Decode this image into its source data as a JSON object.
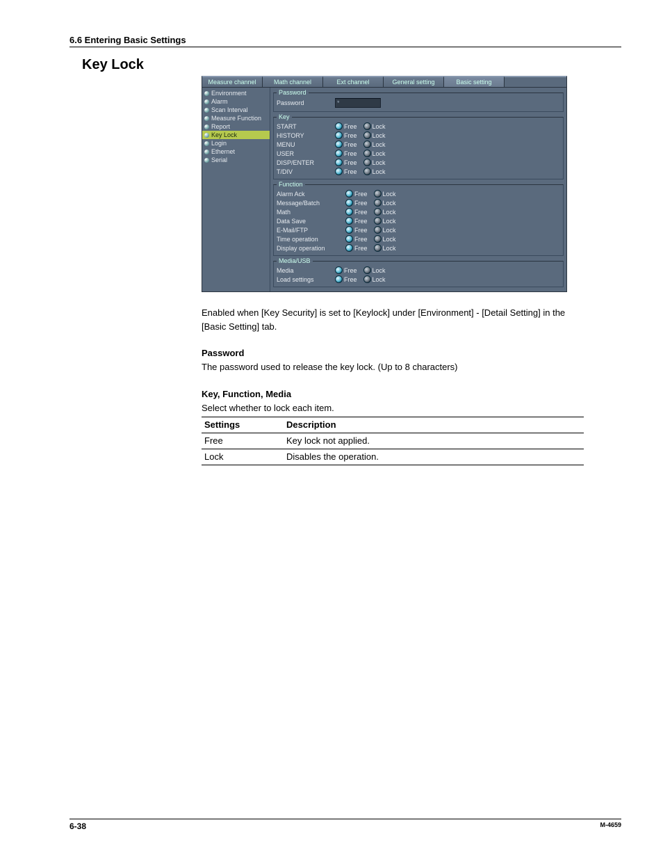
{
  "page": {
    "section_header": "6.6  Entering Basic Settings",
    "title": "Key Lock",
    "page_number": "6-38",
    "doc_id": "M-4659"
  },
  "screenshot": {
    "tabs": [
      "Measure channel",
      "Math channel",
      "Ext channel",
      "General setting",
      "Basic setting"
    ],
    "active_tab_index": 4,
    "sidebar": [
      "Environment",
      "Alarm",
      "Scan Interval",
      "Measure Function",
      "Report",
      "Key Lock",
      "Login",
      "Ethernet",
      "Serial"
    ],
    "sidebar_selected_index": 5,
    "groups": {
      "password": {
        "legend": "Password",
        "label": "Password",
        "value": "*"
      },
      "key": {
        "legend": "Key",
        "items": [
          "START",
          "HISTORY",
          "MENU",
          "USER",
          "DISP/ENTER",
          "T/DIV"
        ]
      },
      "function": {
        "legend": "Function",
        "items": [
          "Alarm Ack",
          "Message/Batch",
          "Math",
          "Data Save",
          "E-Mail/FTP",
          "Time operation",
          "Display operation"
        ]
      },
      "media": {
        "legend": "Media/USB",
        "items": [
          "Media",
          "Load settings"
        ]
      }
    },
    "radio_labels": {
      "free": "Free",
      "lock": "Lock"
    }
  },
  "body": {
    "enabled_note": "Enabled when [Key Security] is set to [Keylock] under [Environment] - [Detail Setting] in the [Basic Setting] tab.",
    "password_head": "Password",
    "password_text": "The password used to release the key lock.  (Up to 8 characters)",
    "kfm_head": "Key, Function, Media",
    "kfm_text": "Select whether to lock each item.",
    "table": {
      "headers": [
        "Settings",
        "Description"
      ],
      "rows": [
        [
          "Free",
          "Key lock not applied."
        ],
        [
          "Lock",
          "Disables the operation."
        ]
      ]
    }
  }
}
